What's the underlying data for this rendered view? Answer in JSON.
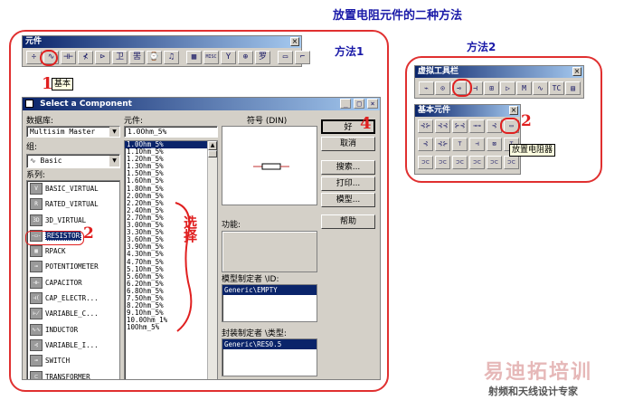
{
  "page_title": "放置电阻元件的二种方法",
  "method1_label": "方法1",
  "method2_label": "方法2",
  "components_toolbar": {
    "title": "元件",
    "close": "×",
    "buttons": [
      "÷",
      "∿",
      "⊣⊢",
      "⊀",
      "⊳",
      "卫",
      "罟",
      "⌚",
      "♫",
      "▦",
      "MISC",
      "Y",
      "⊕",
      "罗",
      "▭",
      "⌐"
    ],
    "tooltip": "基本"
  },
  "dialog": {
    "title": "Select a Component",
    "title_controls": [
      "_",
      "□",
      "×"
    ],
    "database_label": "数据库:",
    "database_value": "Multisim Master",
    "group_label": "组:",
    "group_value": "Basic",
    "family_label": "系列:",
    "families": [
      "BASIC_VIRTUAL",
      "RATED_VIRTUAL",
      "3D_VIRTUAL",
      "RESISTOR",
      "RPACK",
      "POTENTIOMETER",
      "CAPACITOR",
      "CAP_ELECTR...",
      "VARIABLE_C...",
      "INDUCTOR",
      "VARIABLE_I...",
      "SWITCH",
      "TRANSFORMER"
    ],
    "family_icons": [
      "V",
      "R",
      "3D",
      "-▭-",
      "▦",
      "⊸",
      "⊣⊢",
      "⊣(",
      "⊬",
      "∿∿",
      "⊰",
      "⊸",
      "⊏"
    ],
    "selected_family": "RESISTOR",
    "component_label": "元件:",
    "component_value": "1.0Ohm_5%",
    "values": [
      "1.0Ohm_5%",
      "1.1Ohm_5%",
      "1.2Ohm_5%",
      "1.3Ohm_5%",
      "1.5Ohm_5%",
      "1.6Ohm_5%",
      "1.8Ohm_5%",
      "2.0Ohm_5%",
      "2.2Ohm_5%",
      "2.4Ohm_5%",
      "2.7Ohm_5%",
      "3.0Ohm_5%",
      "3.3Ohm_5%",
      "3.6Ohm_5%",
      "3.9Ohm_5%",
      "4.3Ohm_5%",
      "4.7Ohm_5%",
      "5.1Ohm_5%",
      "5.6Ohm_5%",
      "6.2Ohm_5%",
      "6.8Ohm_5%",
      "7.5Ohm_5%",
      "8.2Ohm_5%",
      "9.1Ohm_5%",
      "10.0Ohm_1%",
      "10Ohm_5%"
    ],
    "symbol_label": "符号 (DIN)",
    "function_label": "功能:",
    "model_maker_label": "模型制定者 \\ID:",
    "model_maker_value": "Generic\\EMPTY",
    "package_maker_label": "封装制定者 \\类型:",
    "package_maker_value": "Generic\\RES0.5",
    "buttons": {
      "ok": "好",
      "cancel": "取消",
      "search": "搜索...",
      "print": "打印...",
      "model": "模型...",
      "help": "帮助"
    }
  },
  "virtual_toolbar": {
    "title": "虚拟工具栏",
    "close": "×",
    "buttons": [
      "⌁",
      "⊙",
      "⊸",
      "⊣",
      "⊞",
      "▷",
      "M",
      "∿",
      "TC",
      "▤"
    ]
  },
  "basic_toolbar": {
    "title": "基本元件",
    "close": "×",
    "buttons": [
      "⊰⊱",
      "⊰⊰",
      "⊱⊰",
      "⊸⊸",
      "⊰",
      "▭",
      "⊰",
      "⊰⊱",
      "⊤",
      "⊣",
      "⊠",
      "⊤",
      "⊃⊂",
      "⊃⊂",
      "⊃⊂",
      "⊃⊂",
      "⊃⊂",
      "⊃⊂"
    ],
    "tooltip": "放置电阻器"
  },
  "annotations": {
    "mark1": "1",
    "mark2_dialog": "2",
    "mark2_toolbar": "2",
    "mark4": "4",
    "note": "选择"
  },
  "watermark": {
    "line1": "易迪拓培训",
    "line2": "射频和天线设计专家"
  },
  "colors": {
    "accent_blue": "#1a1aa8",
    "annotation_red": "#e02020",
    "titlebar": "#0a246a",
    "panel": "#d4d0c8"
  }
}
